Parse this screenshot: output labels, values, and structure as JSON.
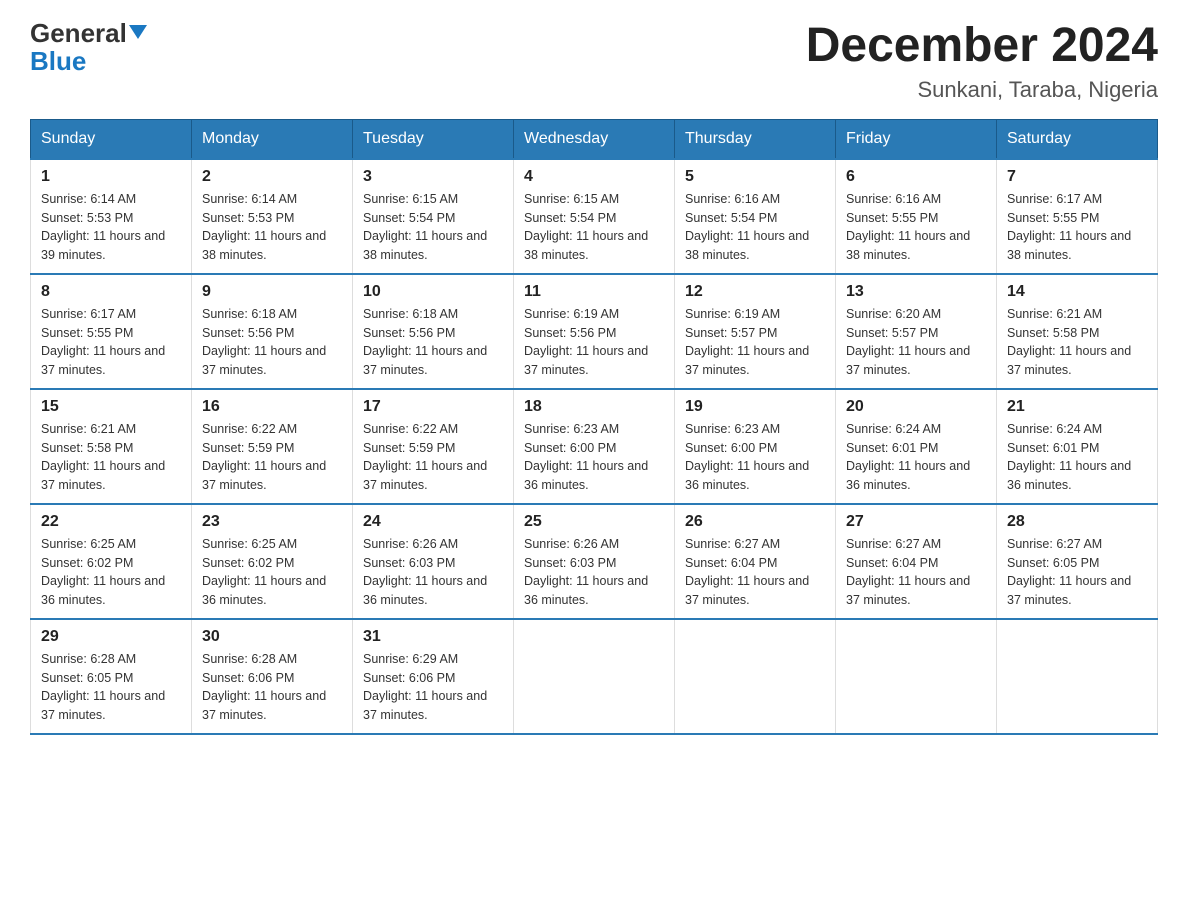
{
  "header": {
    "logo_general": "General",
    "logo_blue": "Blue",
    "month_title": "December 2024",
    "location": "Sunkani, Taraba, Nigeria"
  },
  "days_of_week": [
    "Sunday",
    "Monday",
    "Tuesday",
    "Wednesday",
    "Thursday",
    "Friday",
    "Saturday"
  ],
  "weeks": [
    [
      {
        "day": "1",
        "sunrise": "6:14 AM",
        "sunset": "5:53 PM",
        "daylight": "11 hours and 39 minutes."
      },
      {
        "day": "2",
        "sunrise": "6:14 AM",
        "sunset": "5:53 PM",
        "daylight": "11 hours and 38 minutes."
      },
      {
        "day": "3",
        "sunrise": "6:15 AM",
        "sunset": "5:54 PM",
        "daylight": "11 hours and 38 minutes."
      },
      {
        "day": "4",
        "sunrise": "6:15 AM",
        "sunset": "5:54 PM",
        "daylight": "11 hours and 38 minutes."
      },
      {
        "day": "5",
        "sunrise": "6:16 AM",
        "sunset": "5:54 PM",
        "daylight": "11 hours and 38 minutes."
      },
      {
        "day": "6",
        "sunrise": "6:16 AM",
        "sunset": "5:55 PM",
        "daylight": "11 hours and 38 minutes."
      },
      {
        "day": "7",
        "sunrise": "6:17 AM",
        "sunset": "5:55 PM",
        "daylight": "11 hours and 38 minutes."
      }
    ],
    [
      {
        "day": "8",
        "sunrise": "6:17 AM",
        "sunset": "5:55 PM",
        "daylight": "11 hours and 37 minutes."
      },
      {
        "day": "9",
        "sunrise": "6:18 AM",
        "sunset": "5:56 PM",
        "daylight": "11 hours and 37 minutes."
      },
      {
        "day": "10",
        "sunrise": "6:18 AM",
        "sunset": "5:56 PM",
        "daylight": "11 hours and 37 minutes."
      },
      {
        "day": "11",
        "sunrise": "6:19 AM",
        "sunset": "5:56 PM",
        "daylight": "11 hours and 37 minutes."
      },
      {
        "day": "12",
        "sunrise": "6:19 AM",
        "sunset": "5:57 PM",
        "daylight": "11 hours and 37 minutes."
      },
      {
        "day": "13",
        "sunrise": "6:20 AM",
        "sunset": "5:57 PM",
        "daylight": "11 hours and 37 minutes."
      },
      {
        "day": "14",
        "sunrise": "6:21 AM",
        "sunset": "5:58 PM",
        "daylight": "11 hours and 37 minutes."
      }
    ],
    [
      {
        "day": "15",
        "sunrise": "6:21 AM",
        "sunset": "5:58 PM",
        "daylight": "11 hours and 37 minutes."
      },
      {
        "day": "16",
        "sunrise": "6:22 AM",
        "sunset": "5:59 PM",
        "daylight": "11 hours and 37 minutes."
      },
      {
        "day": "17",
        "sunrise": "6:22 AM",
        "sunset": "5:59 PM",
        "daylight": "11 hours and 37 minutes."
      },
      {
        "day": "18",
        "sunrise": "6:23 AM",
        "sunset": "6:00 PM",
        "daylight": "11 hours and 36 minutes."
      },
      {
        "day": "19",
        "sunrise": "6:23 AM",
        "sunset": "6:00 PM",
        "daylight": "11 hours and 36 minutes."
      },
      {
        "day": "20",
        "sunrise": "6:24 AM",
        "sunset": "6:01 PM",
        "daylight": "11 hours and 36 minutes."
      },
      {
        "day": "21",
        "sunrise": "6:24 AM",
        "sunset": "6:01 PM",
        "daylight": "11 hours and 36 minutes."
      }
    ],
    [
      {
        "day": "22",
        "sunrise": "6:25 AM",
        "sunset": "6:02 PM",
        "daylight": "11 hours and 36 minutes."
      },
      {
        "day": "23",
        "sunrise": "6:25 AM",
        "sunset": "6:02 PM",
        "daylight": "11 hours and 36 minutes."
      },
      {
        "day": "24",
        "sunrise": "6:26 AM",
        "sunset": "6:03 PM",
        "daylight": "11 hours and 36 minutes."
      },
      {
        "day": "25",
        "sunrise": "6:26 AM",
        "sunset": "6:03 PM",
        "daylight": "11 hours and 36 minutes."
      },
      {
        "day": "26",
        "sunrise": "6:27 AM",
        "sunset": "6:04 PM",
        "daylight": "11 hours and 37 minutes."
      },
      {
        "day": "27",
        "sunrise": "6:27 AM",
        "sunset": "6:04 PM",
        "daylight": "11 hours and 37 minutes."
      },
      {
        "day": "28",
        "sunrise": "6:27 AM",
        "sunset": "6:05 PM",
        "daylight": "11 hours and 37 minutes."
      }
    ],
    [
      {
        "day": "29",
        "sunrise": "6:28 AM",
        "sunset": "6:05 PM",
        "daylight": "11 hours and 37 minutes."
      },
      {
        "day": "30",
        "sunrise": "6:28 AM",
        "sunset": "6:06 PM",
        "daylight": "11 hours and 37 minutes."
      },
      {
        "day": "31",
        "sunrise": "6:29 AM",
        "sunset": "6:06 PM",
        "daylight": "11 hours and 37 minutes."
      },
      null,
      null,
      null,
      null
    ]
  ],
  "labels": {
    "sunrise": "Sunrise:",
    "sunset": "Sunset:",
    "daylight": "Daylight:"
  }
}
